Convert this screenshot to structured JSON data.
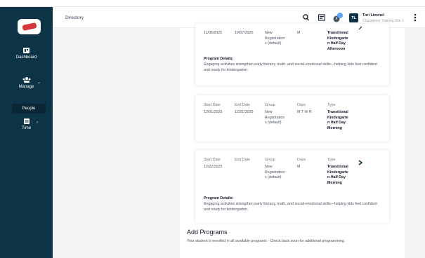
{
  "nav": {
    "dashboard": "Dashboard",
    "manage": "Manage",
    "people": "People",
    "time": "Time"
  },
  "header": {
    "breadcrumb": "Directory",
    "user_initials": "TL",
    "user_name": "Tori Limmel",
    "user_org": "Champions Training Site 1"
  },
  "cards": [
    {
      "start": "11/03/2025",
      "end": "10/07/2025",
      "group": [
        "New",
        "Registration",
        "s (default)"
      ],
      "days": "M",
      "type": [
        "Transitional",
        "Kindergarte",
        "n Half Day",
        "Afternoon"
      ],
      "details_label": "Program Details:",
      "details": "Engaging activities strengthen early literacy, math, and social-emotional skills—helping kids feel confident and ready for kindergarten."
    },
    {
      "headers": {
        "start": "Start Date",
        "end": "End Date",
        "group": "Group",
        "days": "Days",
        "type": "Type"
      },
      "start": "12/01/2025",
      "end": "12/21/2025",
      "group": [
        "New",
        "Registration",
        "s (default)"
      ],
      "days": "M T W R",
      "type": [
        "Transitional",
        "Kindergarte",
        "n Half Day",
        "Morning"
      ]
    },
    {
      "headers": {
        "start": "Start Date",
        "end": "End Date",
        "group": "Group",
        "days": "Days",
        "type": "Type"
      },
      "start": "12/22/2025",
      "end": "",
      "group": [
        "New",
        "Registration",
        "s (default)"
      ],
      "days": "M",
      "type": [
        "Transitional",
        "Kindergarte",
        "n Half Day",
        "Morning"
      ],
      "details_label": "Program Details:",
      "details": "Engaging activities strengthen early literacy, math, and social-emotional skills—helping kids feel confident and ready for kindergarten."
    }
  ],
  "add_programs": {
    "title": "Add Programs",
    "subtitle": "Your student is enrolled in all available programs - Check back soon for additional programming."
  },
  "colors": {
    "sidebar": "#0d3347",
    "accent": "#0d3347",
    "logo_red": "#d43838",
    "notification_badge": "#60a5fa"
  },
  "icons": [
    "logo-icon",
    "dashboard-icon",
    "manage-icon",
    "time-icon",
    "search-icon",
    "news-icon",
    "notification-icon",
    "more-vertical-icon",
    "chevron-right-icon",
    "edit-icon"
  ]
}
